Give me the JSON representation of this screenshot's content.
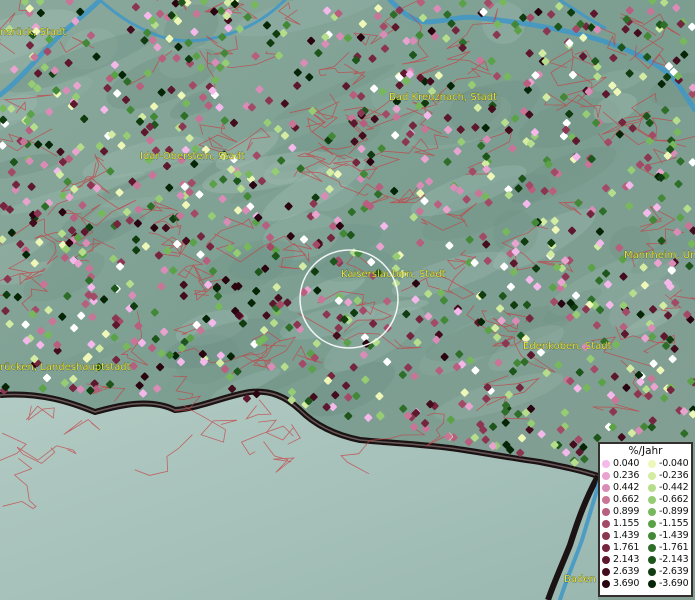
{
  "map": {
    "cities": [
      {
        "name": "Hunsrück, Stadt",
        "display": "nsrück, Stadt"
      },
      {
        "name": "Bad Kreuznach, Stadt",
        "display": "Bad Kreuznach, Stadt"
      },
      {
        "name": "Idar-Oberstein, Stadt",
        "display": "Idar-Oberstein, Stadt"
      },
      {
        "name": "Kaiserslautern, Stadt",
        "display": "Kaiserslautern, Stadt"
      },
      {
        "name": "Mannheim, Universitätsstadt",
        "display": "Mannheim, Uni"
      },
      {
        "name": "Edenkoben, Stadt",
        "display": "Edenkoben, Stadt"
      },
      {
        "name": "Saarbrücken, Landeshauptstadt",
        "display": "rücken, Landeshauptstadt"
      },
      {
        "name": "Baden",
        "display": "Baden"
      }
    ],
    "colors": {
      "terrain": "#7fa396",
      "terrain_light": "#a9c2b9",
      "boundaries": "#c64045",
      "rivers": "#3f97c7",
      "lowland": "#a5c3bb",
      "border_dark": "#1b1214"
    }
  },
  "legend": {
    "title": "%/Jahr",
    "positive": [
      {
        "value": "0.040",
        "color": "#f4b8ea"
      },
      {
        "value": "0.236",
        "color": "#e9a3cf"
      },
      {
        "value": "0.442",
        "color": "#d98cb6"
      },
      {
        "value": "0.662",
        "color": "#c97597"
      },
      {
        "value": "0.899",
        "color": "#b85e7e"
      },
      {
        "value": "1.155",
        "color": "#a34a67"
      },
      {
        "value": "1.439",
        "color": "#8c3752"
      },
      {
        "value": "1.761",
        "color": "#75263f"
      },
      {
        "value": "2.143",
        "color": "#5d182e"
      },
      {
        "value": "2.639",
        "color": "#440d1e"
      },
      {
        "value": "3.690",
        "color": "#2a0410"
      }
    ],
    "negative": [
      {
        "value": "-0.040",
        "color": "#eef7b7"
      },
      {
        "value": "-0.236",
        "color": "#d3eca2"
      },
      {
        "value": "-0.442",
        "color": "#b5dd8b"
      },
      {
        "value": "-0.662",
        "color": "#96cc73"
      },
      {
        "value": "-0.899",
        "color": "#77b85d"
      },
      {
        "value": "-1.155",
        "color": "#5aa148"
      },
      {
        "value": "-1.439",
        "color": "#428837"
      },
      {
        "value": "-1.761",
        "color": "#2e6e28"
      },
      {
        "value": "-2.143",
        "color": "#1d551b"
      },
      {
        "value": "-2.639",
        "color": "#103c10"
      },
      {
        "value": "-3.690",
        "color": "#062506"
      }
    ]
  }
}
